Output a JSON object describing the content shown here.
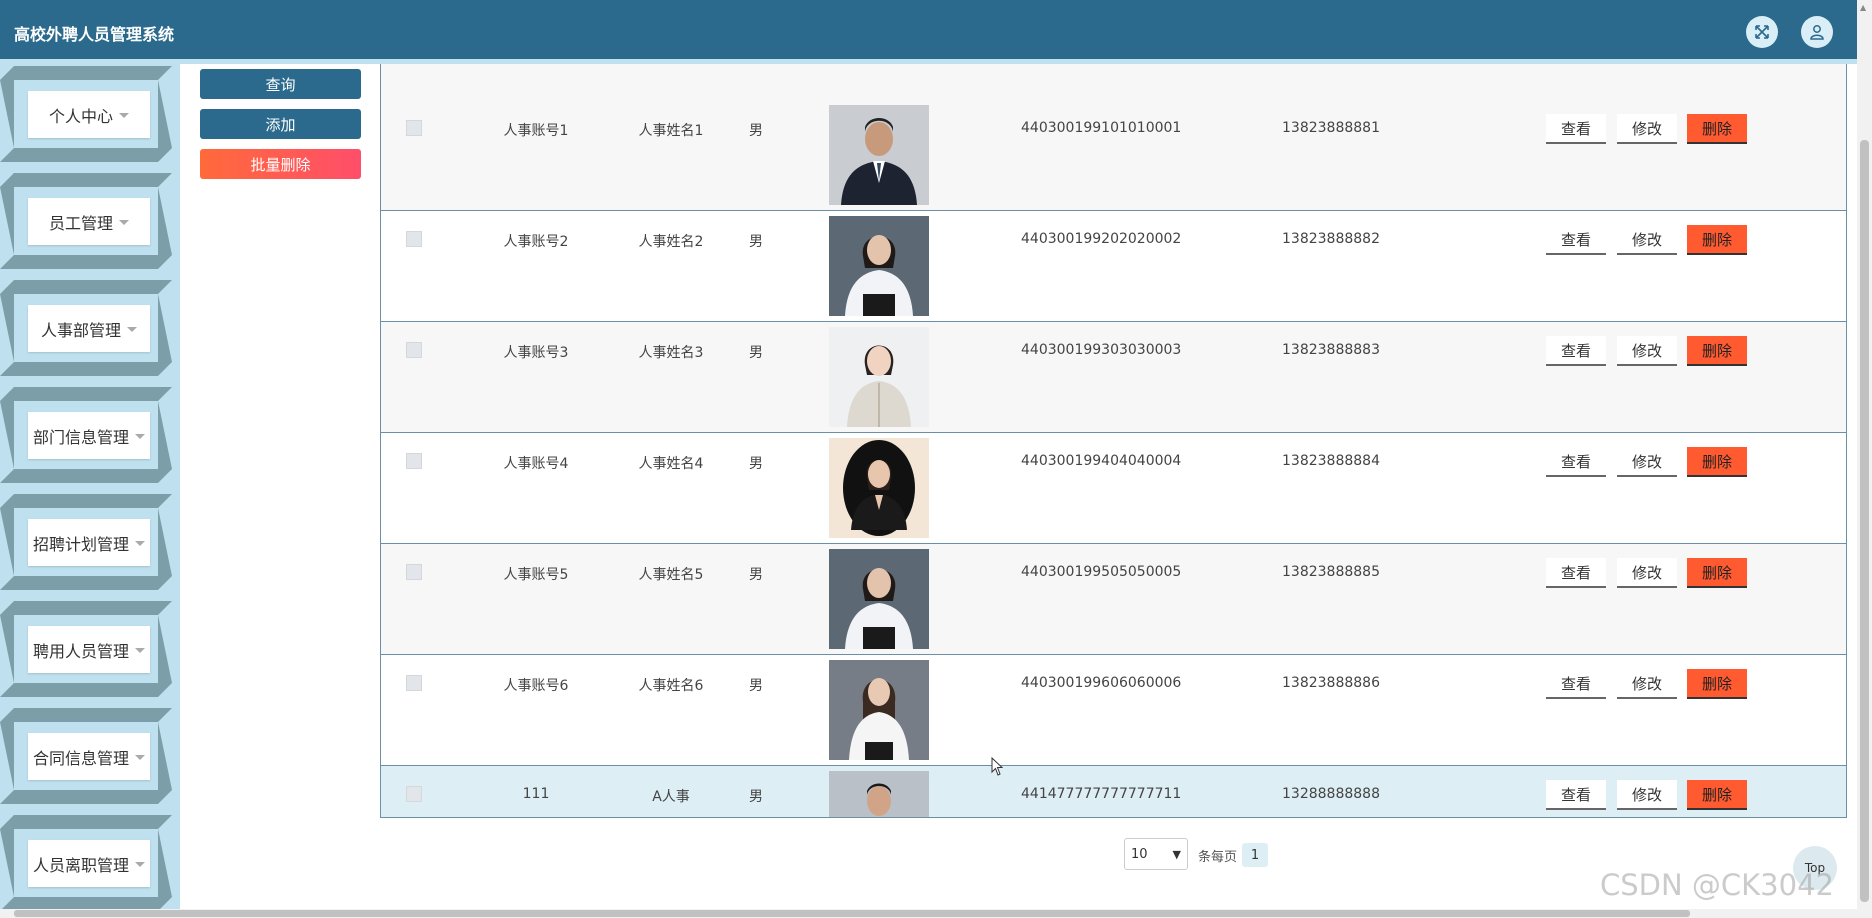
{
  "app": {
    "title": "高校外聘人员管理系统"
  },
  "header": {
    "fullscreen_icon": "fullscreen-icon",
    "user_icon": "user-icon"
  },
  "sidebar": {
    "items": [
      {
        "label": "个人中心"
      },
      {
        "label": "员工管理"
      },
      {
        "label": "人事部管理"
      },
      {
        "label": "部门信息管理"
      },
      {
        "label": "招聘计划管理"
      },
      {
        "label": "聘用人员管理"
      },
      {
        "label": "合同信息管理"
      },
      {
        "label": "人员离职管理"
      }
    ]
  },
  "actions": {
    "search": "查询",
    "add": "添加",
    "batch_delete": "批量删除"
  },
  "table": {
    "rows": [
      {
        "account": "人事账号1",
        "name": "人事姓名1",
        "gender": "男",
        "id_card": "440300199101010001",
        "phone": "13823888881"
      },
      {
        "account": "人事账号2",
        "name": "人事姓名2",
        "gender": "男",
        "id_card": "440300199202020002",
        "phone": "13823888882"
      },
      {
        "account": "人事账号3",
        "name": "人事姓名3",
        "gender": "男",
        "id_card": "440300199303030003",
        "phone": "13823888883"
      },
      {
        "account": "人事账号4",
        "name": "人事姓名4",
        "gender": "男",
        "id_card": "440300199404040004",
        "phone": "13823888884"
      },
      {
        "account": "人事账号5",
        "name": "人事姓名5",
        "gender": "男",
        "id_card": "440300199505050005",
        "phone": "13823888885"
      },
      {
        "account": "人事账号6",
        "name": "人事姓名6",
        "gender": "男",
        "id_card": "440300199606060006",
        "phone": "13823888886"
      },
      {
        "account": "111",
        "name": "A人事",
        "gender": "男",
        "id_card": "441477777777777711",
        "phone": "13288888888"
      }
    ],
    "ops": {
      "view": "查看",
      "edit": "修改",
      "delete": "删除"
    }
  },
  "pagination": {
    "page_size": "10",
    "per_page_label": "条每页",
    "current_page": "1"
  },
  "back_to_top": "Top",
  "watermark": "CSDN @CK3042",
  "colors": {
    "header": "#2b6a8c",
    "sidebar": "#bfe1ef",
    "danger": "#ff5a30",
    "highlight_row": "#deeef5"
  }
}
